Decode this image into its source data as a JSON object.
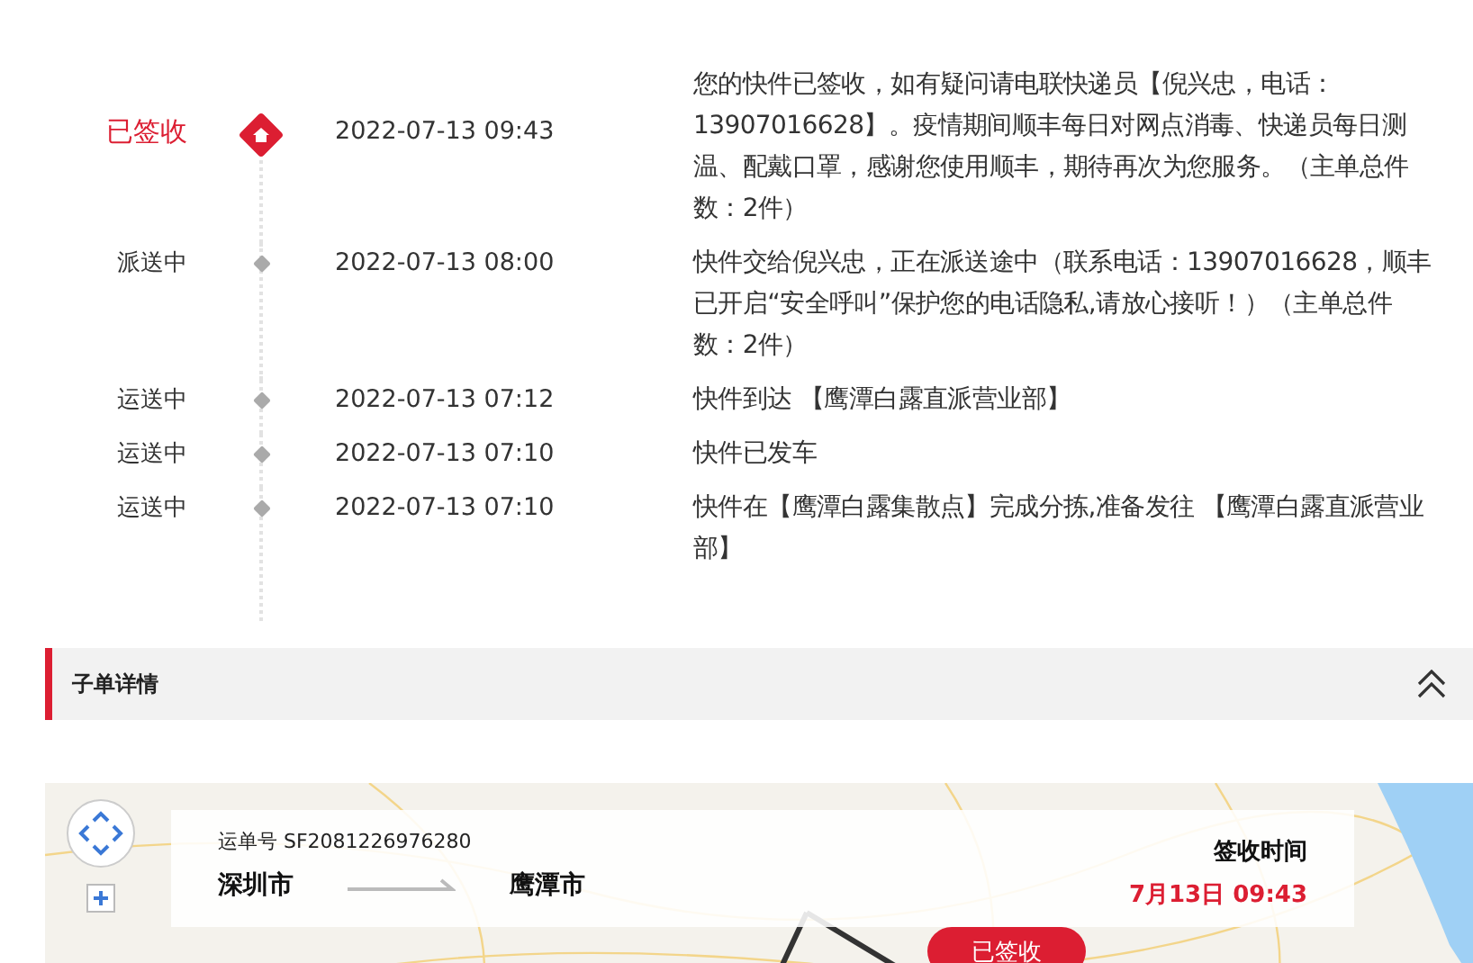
{
  "timeline": [
    {
      "kind": "signed",
      "status": "已签收",
      "time": "2022-07-13 09:43",
      "description": "您的快件已签收，如有疑问请电联快递员【倪兴忠，电话：13907016628】。疫情期间顺丰每日对网点消毒、快递员每日测温、配戴口罩，感谢您使用顺丰，期待再次为您服务。（主单总件数：2件）"
    },
    {
      "kind": "transit",
      "status": "派送中",
      "time": "2022-07-13 08:00",
      "description": "快件交给倪兴忠，正在派送途中（联系电话：13907016628，顺丰已开启“安全呼叫”保护您的电话隐私,请放心接听！）（主单总件数：2件）"
    },
    {
      "kind": "transit",
      "status": "运送中",
      "time": "2022-07-13 07:12",
      "description": "快件到达 【鹰潭白露直派营业部】"
    },
    {
      "kind": "transit",
      "status": "运送中",
      "time": "2022-07-13 07:10",
      "description": "快件已发车"
    },
    {
      "kind": "transit",
      "status": "运送中",
      "time": "2022-07-13 07:10",
      "description": "快件在【鹰潭白露集散点】完成分拣,准备发往 【鹰潭白露直派营业部】"
    }
  ],
  "section": {
    "title": "子单详情",
    "expanded": true
  },
  "map": {
    "waybill": "运单号 SF2081226976280",
    "from": "深圳市",
    "to": "鹰潭市",
    "time_label": "签收时间",
    "time": "7月13日 09:43",
    "badge": "已签收"
  }
}
